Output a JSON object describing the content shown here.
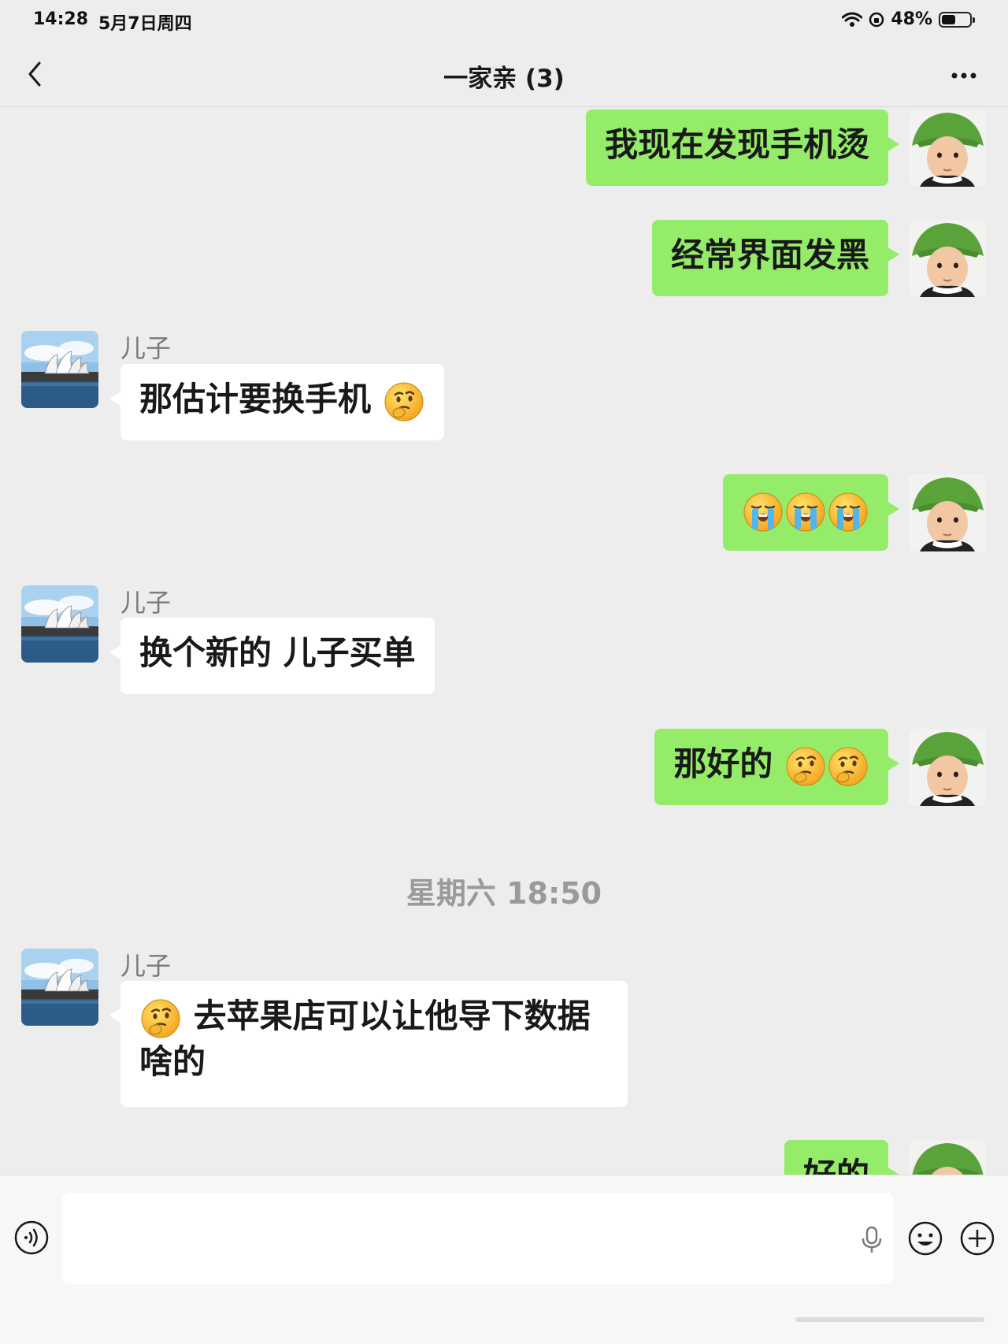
{
  "status_bar": {
    "time": "14:28",
    "date": "5月7日周四",
    "battery": "48%",
    "battery_level": 0.48
  },
  "nav": {
    "title": "一家亲 (3)"
  },
  "messages": {
    "m1": {
      "text": "我现在发现手机烫"
    },
    "m2": {
      "text": "经常界面发黑"
    },
    "m3": {
      "sender": "儿子",
      "text": "那估计要换手机"
    },
    "m5": {
      "sender": "儿子",
      "text": "换个新的 儿子买单"
    },
    "m6": {
      "text": "那好的"
    },
    "time_divider": "星期六 18:50",
    "m7": {
      "sender": "儿子",
      "line1": "去苹果店可以让他导下数据",
      "line2": "啥的"
    },
    "m8": {
      "text": "好的"
    }
  },
  "icons": {
    "back": "chevron-left-icon",
    "more": "more-dots-icon",
    "voice": "voice-icon",
    "mic": "mic-icon",
    "emoji": "smiley-icon",
    "plus": "plus-icon",
    "thinking_emoji": "thinking-face-icon",
    "crying_emoji": "loudly-crying-face-icon"
  },
  "colors": {
    "my_bubble": "#95ec69",
    "their_bubble": "#ffffff",
    "background": "#ededed"
  }
}
